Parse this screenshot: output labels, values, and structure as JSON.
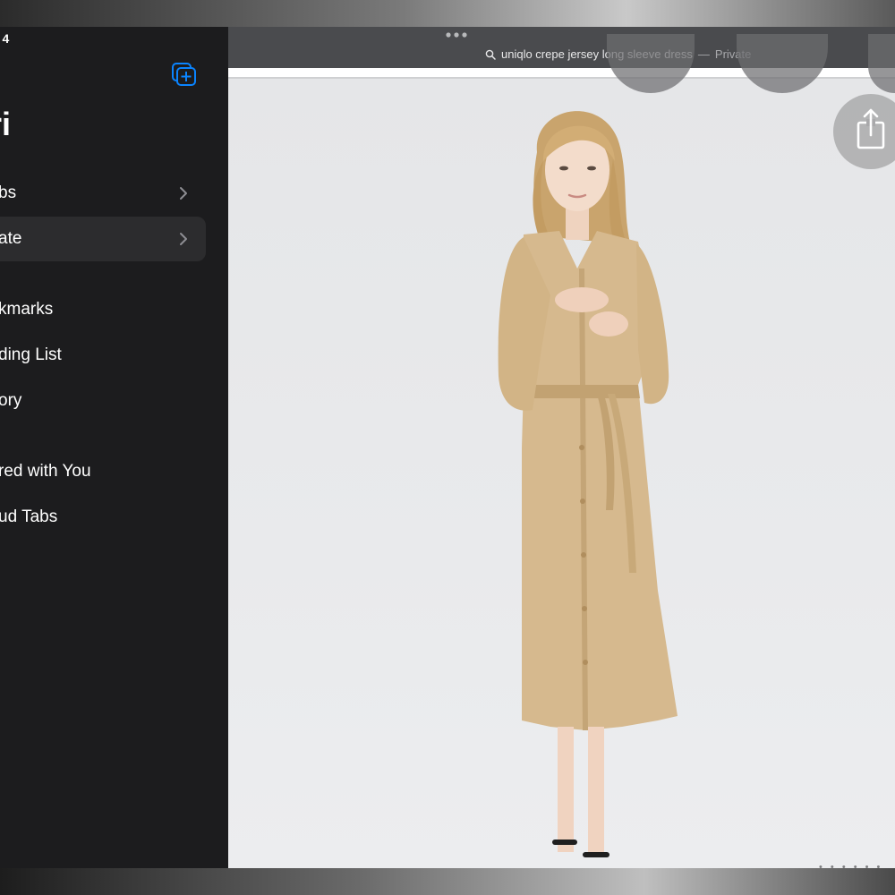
{
  "status": {
    "time": "t 4"
  },
  "sidebar": {
    "title": "ri",
    "items": [
      {
        "label": "bs",
        "has_chevron": true,
        "selected": false
      },
      {
        "label": "ate",
        "has_chevron": true,
        "selected": true
      },
      {
        "label": "kmarks"
      },
      {
        "label": "ding List"
      },
      {
        "label": "ory"
      },
      {
        "label": "red with You"
      },
      {
        "label": "ud Tabs"
      }
    ]
  },
  "addressbar": {
    "query": "uniqlo crepe jersey long sleeve dress",
    "separator": "—",
    "mode": "Private"
  },
  "icons": {
    "new_tab_group": "plus-square-stack-icon",
    "share": "share-icon",
    "search": "magnifier-icon",
    "chevron": "chevron-right-icon",
    "more": "ellipsis-icon"
  },
  "colors": {
    "sidebar_bg": "#1c1c1e",
    "selected_row": "#2c2c2e",
    "accent": "#0a84ff",
    "dress": "#d6b98e"
  }
}
